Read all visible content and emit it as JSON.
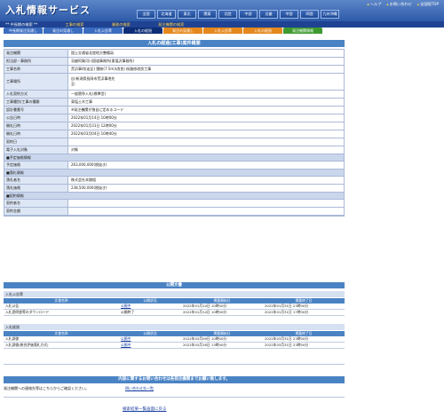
{
  "header": {
    "title": "入札情報サービス",
    "links": [
      "ヘルプ",
      "お問い合わせ",
      "全国版TOP"
    ],
    "regions": [
      "全国",
      "北海道",
      "東北",
      "関東",
      "北陸",
      "中部",
      "近畿",
      "中国",
      "四国",
      "九州沖縄"
    ]
  },
  "search_bar": {
    "left": "** 中長期の検索 **",
    "middle": "工事の検索",
    "right": "業務の検索",
    "far": "発注機関の検索"
  },
  "tabs": [
    {
      "label": "中長期発注見通し",
      "style": "blue"
    },
    {
      "label": "発注の見通し",
      "style": "blue"
    },
    {
      "label": "入札公告等",
      "style": "blue"
    },
    {
      "label": "入札の経過",
      "style": "act"
    },
    {
      "label": "発注の見通し",
      "style": "orange"
    },
    {
      "label": "入札公告等",
      "style": "orange"
    },
    {
      "label": "入札の経過",
      "style": "orange"
    },
    {
      "label": "発注機関情報",
      "style": "green"
    }
  ],
  "page_title": "入札の経過(工事)案件概要",
  "detail": [
    {
      "label": "発注機関",
      "value": "国土交通省北陸地方整備局",
      "h": 9
    },
    {
      "label": "担当部・事務所",
      "value": "羽越阿賀河川国道事務所(東塩沢事務所)",
      "h": 9
    },
    {
      "label": "工事名称",
      "value": "荒浜事(吹走区) 舗装(7.5m)(改良) 街路修改良工事",
      "h": 9
    },
    {
      "label": "工事場所",
      "value": "自:新潟県長岡市荒浜事地先\n至:",
      "h": 19
    },
    {
      "label": "入札契約方式",
      "value": "一般競争入札(標準型)",
      "h": 9
    },
    {
      "label": "工事種別/工事の種類",
      "value": "東塩土木工事",
      "h": 9
    },
    {
      "label": "設計書番号",
      "value": "       ※発注機関が独自に定めるコード",
      "h": 9
    },
    {
      "label": "公告日時",
      "value": "2022年01月14日 10時00分",
      "h": 9
    },
    {
      "label": "開札日時",
      "value": "2022年01月31日 12時00分",
      "h": 9
    },
    {
      "label": "開札日時",
      "value": "2022年03月04日 10時40分",
      "h": 9
    },
    {
      "label": "契約日",
      "value": "",
      "h": 9
    },
    {
      "label": "電子入札対象",
      "value": "対象",
      "h": 9
    }
  ],
  "sections": {
    "yotei": "■予定価格情報",
    "rakusatsu": "■落札情報",
    "keiyaku": "■契約情報"
  },
  "price": {
    "label": "予定価格",
    "value": "263,000,000(税抜き)"
  },
  "winner": [
    {
      "label": "落札者名",
      "value": "株式会社本間組"
    },
    {
      "label": "落札価格",
      "value": "238,500,000(税抜き)"
    }
  ],
  "contract": [
    {
      "label": "契約者名",
      "value": ""
    },
    {
      "label": "契約金額",
      "value": ""
    }
  ],
  "public_docs": {
    "title": "公開文書",
    "group1": "入札公告等",
    "group2": "入札経過",
    "headers": [
      "文書名称",
      "公開状況",
      "掲載開始日",
      "掲載終了日"
    ],
    "rows1": [
      [
        "入札公告",
        "公開中",
        "2022年01月14日 10時00分",
        "2022年01月31日 23時00分"
      ],
      [
        "入札説明書等のダウンロード",
        "公開終了",
        "2022年01月14日 10時00分",
        "2022年01月31日 17時00分"
      ]
    ],
    "rows2": [
      [
        "入札調書",
        "公開中",
        "2022年03月09日 10時00分",
        "2022年03月31日 23時00分"
      ],
      [
        "入札調書(総合評価落札方式)",
        "公開中",
        "2022年03月16日 13時40分",
        "2022年03月31日 23時00分"
      ]
    ]
  },
  "contact": {
    "title": "内容に関するお問い合わせは各発注機関までお願い致します。",
    "text": "発注機関への連絡先等はこちらからご確認ください。",
    "link": "問い合わせ先一覧"
  },
  "back_link": "検索結果一覧画面に戻る"
}
